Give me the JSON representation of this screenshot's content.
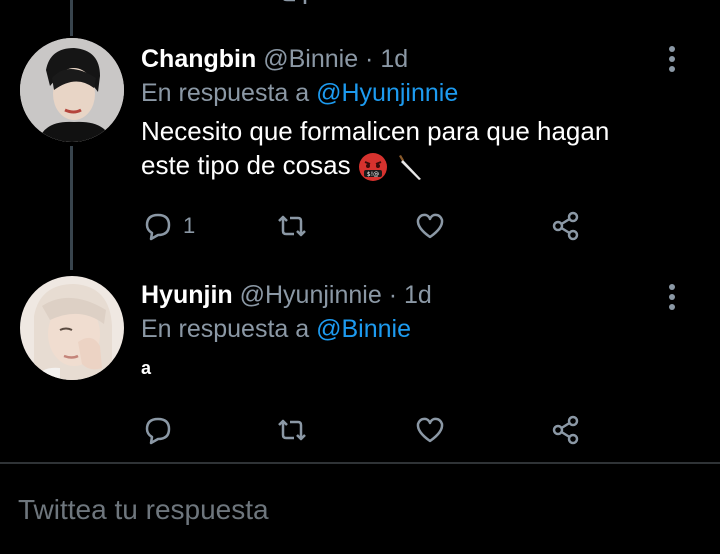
{
  "tweets": [
    {
      "name": "Changbin",
      "handle": "@Binnie",
      "separator": "·",
      "time": "1d",
      "reply_prefix": "En respuesta a",
      "reply_to": "@Hyunjinnie",
      "text": "Necesito que formalicen para que hagan este tipo de cosas",
      "emojis": [
        "face-with-symbols-on-mouth",
        "kitchen-knife"
      ],
      "reply_count": "1",
      "retweet_count": "",
      "like_count": ""
    },
    {
      "name": "Hyunjin",
      "handle": "@Hyunjinnie",
      "separator": "·",
      "time": "1d",
      "reply_prefix": "En respuesta a",
      "reply_to": "@Binnie",
      "text": "a",
      "reply_count": "",
      "retweet_count": "",
      "like_count": ""
    }
  ],
  "compose": {
    "placeholder": "Twittea tu respuesta"
  },
  "colors": {
    "background": "#000000",
    "text": "#ffffff",
    "secondary": "#8b98a5",
    "accent": "#1d9bf0",
    "thread_line": "#38444d",
    "divider": "#2f3336"
  }
}
